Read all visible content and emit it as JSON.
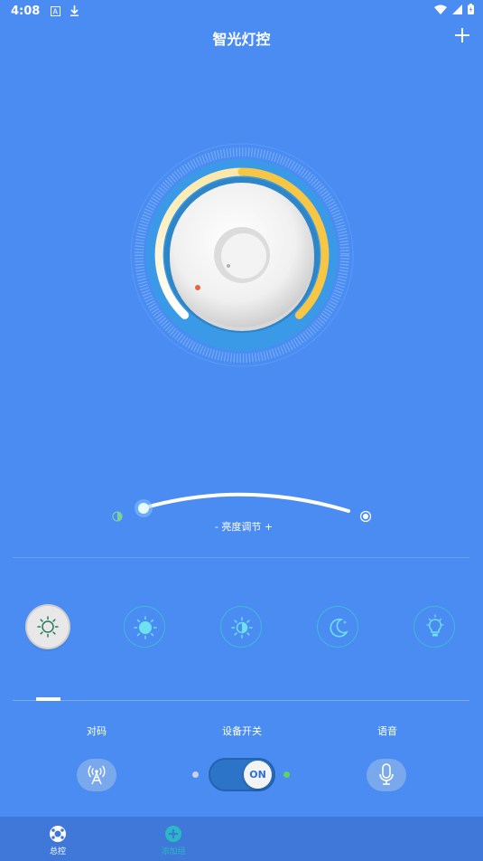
{
  "status_bar": {
    "time": "4:08",
    "icons": [
      "a-icon",
      "download-icon",
      "wifi-icon",
      "signal-icon",
      "battery-icon"
    ]
  },
  "header": {
    "title": "智光灯控",
    "add_icon": "plus-icon"
  },
  "brightness": {
    "label": "- 亮度调节 +",
    "level": 0.08
  },
  "modes": [
    {
      "icon": "sun-outline-icon",
      "active": true
    },
    {
      "icon": "sun-filled-icon",
      "active": false
    },
    {
      "icon": "sun-half-icon",
      "active": false
    },
    {
      "icon": "moon-icon",
      "active": false
    },
    {
      "icon": "bulb-icon",
      "active": false
    }
  ],
  "controls": {
    "pair_label": "对码",
    "power_label": "设备开关",
    "voice_label": "语音",
    "toggle_text": "ON"
  },
  "nav": {
    "items": [
      {
        "label": "总控",
        "icon": "control-icon"
      },
      {
        "label": "添加组",
        "icon": "add-circle-icon"
      }
    ]
  },
  "colors": {
    "background": "#4a8cf2",
    "accent_yellow": "#f6c644",
    "toggle_blue": "#2c74c8",
    "on_green": "#5ed35e"
  }
}
